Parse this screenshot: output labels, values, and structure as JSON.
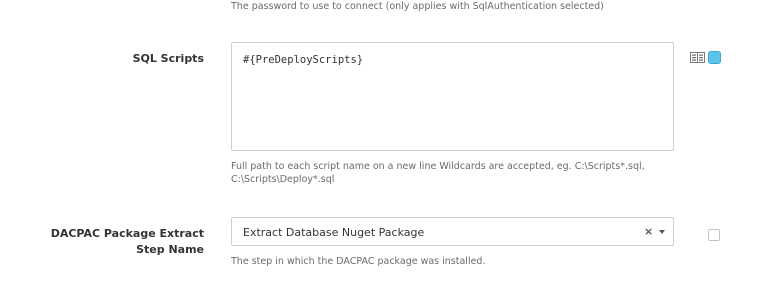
{
  "password_help": "The password to use to connect (only applies with SqlAuthentication selected)",
  "sql_scripts": {
    "label": "SQL Scripts",
    "value": "#{PreDeployScripts}",
    "help_line1": "Full path to each script name on a new line Wildcards are accepted, eg. C:\\Scripts*.sql,",
    "help_line2": "C:\\Scripts\\Deploy*.sql",
    "icons": [
      "bind-toggle-icon",
      "variable-icon"
    ]
  },
  "dacpac_step": {
    "label_line1": "DACPAC Package Extract",
    "label_line2": "Step Name",
    "selected": "Extract Database Nuget Package",
    "clear_glyph": "×",
    "help": "The step in which the DACPAC package was installed.",
    "checkbox_checked": false
  },
  "colors": {
    "accent": "#5ec3e8",
    "help_text": "#6b6b6b",
    "border": "#cfcfcf"
  }
}
